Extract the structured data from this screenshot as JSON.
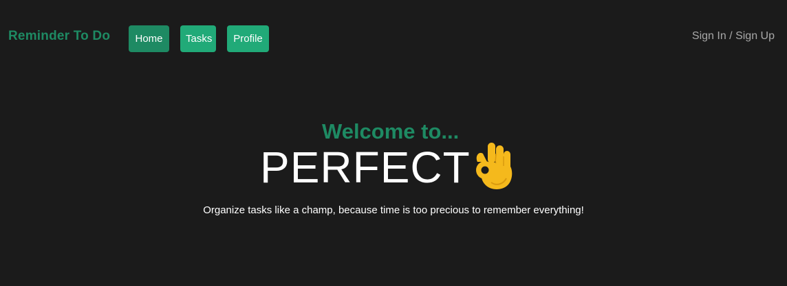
{
  "navbar": {
    "brand": "Reminder To Do",
    "links": [
      {
        "label": "Home"
      },
      {
        "label": "Tasks"
      },
      {
        "label": "Profile"
      }
    ],
    "auth_label": "Sign In / Sign Up"
  },
  "hero": {
    "welcome": "Welcome to...",
    "headline": "PERFECT",
    "headline_icon": "ok-hand-icon",
    "tagline": "Organize tasks like a champ, because time is too precious to remember everything!"
  },
  "colors": {
    "background": "#1b1b1b",
    "accent": "#1e8a63",
    "button": "#21aa78",
    "muted_text": "#a8a8a8"
  }
}
